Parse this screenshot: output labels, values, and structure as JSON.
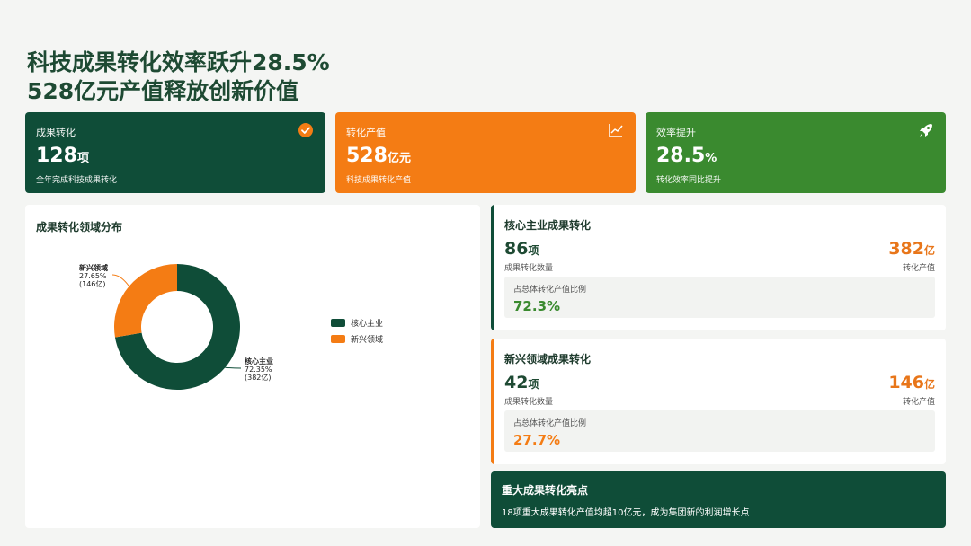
{
  "title": {
    "line1": "科技成果转化效率跃升28.5%",
    "line2": "528亿元产值释放创新价值"
  },
  "kpis": [
    {
      "label": "成果转化",
      "value": "128",
      "unit": "项",
      "desc": "全年完成科技成果转化",
      "icon": "check-circle-icon",
      "color": "#0f4d38"
    },
    {
      "label": "转化产值",
      "value": "528",
      "unit": "亿元",
      "desc": "科技成果转化产值",
      "icon": "line-chart-icon",
      "color": "#f47c14"
    },
    {
      "label": "效率提升",
      "value": "28.5",
      "unit": "%",
      "desc": "转化效率同比提升",
      "icon": "rocket-icon",
      "color": "#3a8a2f"
    }
  ],
  "chart_data": {
    "type": "pie",
    "title": "成果转化领域分布",
    "categories": [
      "核心主业",
      "新兴领域"
    ],
    "values": [
      382,
      146
    ],
    "percentages": [
      72.35,
      27.65
    ],
    "colors": [
      "#0f4d38",
      "#f47c14"
    ],
    "labels": [
      {
        "name": "核心主业",
        "pct": "72.35%",
        "amount": "(382亿)"
      },
      {
        "name": "新兴领域",
        "pct": "27.65%",
        "amount": "(146亿)"
      }
    ],
    "donut": true,
    "legend": "right"
  },
  "core": {
    "title": "核心主业成果转化",
    "count": "86",
    "count_unit": "项",
    "count_label": "成果转化数量",
    "amount": "382",
    "amount_unit": "亿",
    "amount_label": "转化产值",
    "ratio_label": "占总体转化产值比例",
    "ratio": "72.3%",
    "accent": "#1e4a33",
    "ratio_color": "#3a8a2f"
  },
  "emerging": {
    "title": "新兴领域成果转化",
    "count": "42",
    "count_unit": "项",
    "count_label": "成果转化数量",
    "amount": "146",
    "amount_unit": "亿",
    "amount_label": "转化产值",
    "ratio_label": "占总体转化产值比例",
    "ratio": "27.7%",
    "accent": "#f47c14",
    "ratio_color": "#f47c14"
  },
  "highlight": {
    "title": "重大成果转化亮点",
    "text": "18项重大成果转化产值均超10亿元，成为集团新的利润增长点"
  }
}
